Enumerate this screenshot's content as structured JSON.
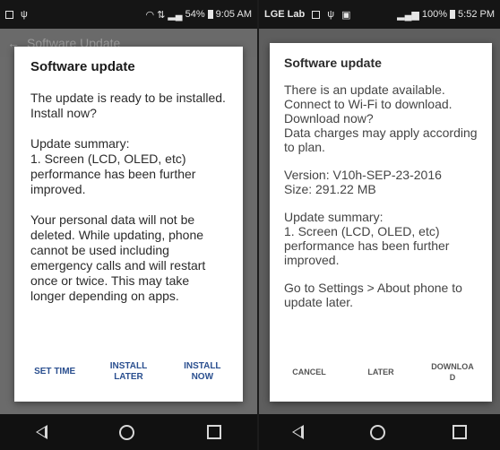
{
  "left": {
    "status": {
      "battery_percent": "54%",
      "time": "9:05 AM"
    },
    "appbar": {
      "title": "Software Update"
    },
    "dialog": {
      "title": "Software update",
      "paragraphs": [
        "The update is ready to be installed. Install now?",
        "Update summary:\n1. Screen (LCD, OLED, etc) performance has been further improved.",
        "Your personal data will not be deleted. While updating, phone cannot be used including emergency calls and will restart once or twice. This may take longer depending on apps."
      ],
      "buttons": [
        {
          "label": "SET TIME"
        },
        {
          "label": "INSTALL\nLATER"
        },
        {
          "label": "INSTALL\nNOW"
        }
      ]
    }
  },
  "right": {
    "status": {
      "carrier": "LGE Lab",
      "battery_percent": "100%",
      "time": "5:52 PM"
    },
    "dialog": {
      "title": "Software update",
      "paragraphs": [
        "There is an update available. Connect to Wi-Fi to download. Download now?\nData charges may apply according to plan.",
        "Version: V10h-SEP-23-2016\nSize: 291.22 MB",
        "Update summary:\n1. Screen (LCD, OLED, etc) performance has been further improved.",
        "Go to Settings > About phone to update later."
      ],
      "buttons": [
        {
          "label": "CANCEL"
        },
        {
          "label": "LATER"
        },
        {
          "label": "DOWNLOA\nD"
        }
      ]
    }
  },
  "colors": {
    "dialog_bg": "#ffffff",
    "left_button_text": "#2a4f8f",
    "right_button_text": "#555555",
    "statusbar_bg": "#151515"
  }
}
